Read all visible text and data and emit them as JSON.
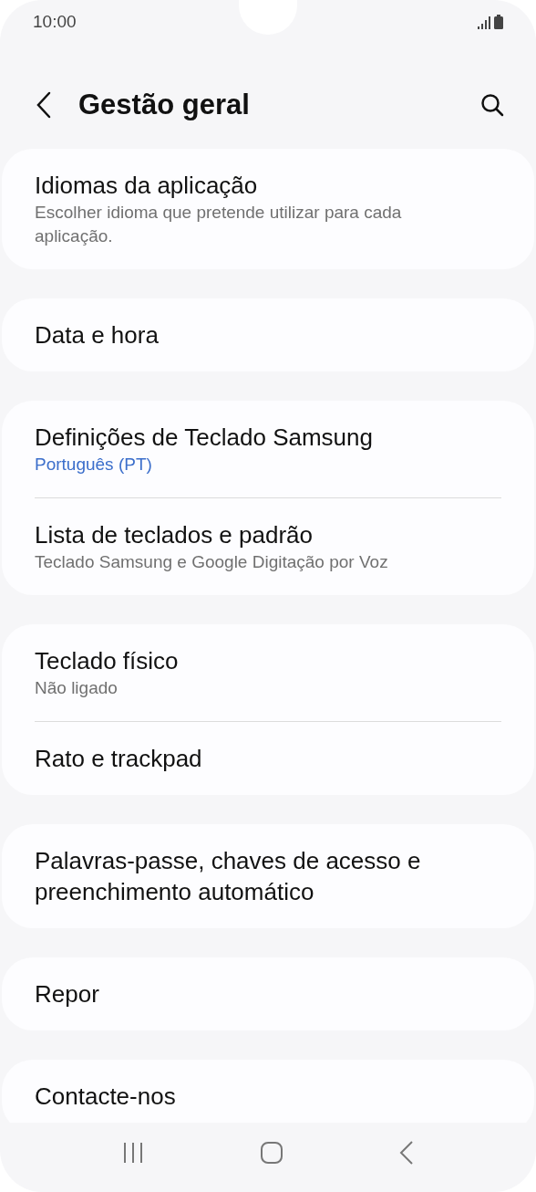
{
  "status_bar": {
    "time": "10:00"
  },
  "header": {
    "title": "Gestão geral"
  },
  "cards": [
    {
      "items": [
        {
          "title": "Idiomas da aplicação",
          "subtitle": {
            "text": "Escolher idioma que pretende utilizar para cada aplicação.",
            "color": "#707070"
          }
        }
      ]
    },
    {
      "items": [
        {
          "title": "Data e hora"
        }
      ]
    },
    {
      "items": [
        {
          "title": "Definições de Teclado Samsung",
          "subtitle": {
            "text": "Português (PT)",
            "color": "#3b6ecb"
          }
        },
        {
          "title": "Lista de teclados e padrão",
          "subtitle": {
            "text": "Teclado Samsung e Google Digitação por Voz",
            "color": "#707070"
          }
        }
      ]
    },
    {
      "items": [
        {
          "title": "Teclado físico",
          "subtitle": {
            "text": "Não ligado",
            "color": "#707070"
          }
        },
        {
          "title": "Rato e trackpad"
        }
      ]
    },
    {
      "items": [
        {
          "title": "Palavras-passe, chaves de acesso e preenchimento automático"
        }
      ]
    },
    {
      "items": [
        {
          "title": "Repor"
        }
      ]
    },
    {
      "items": [
        {
          "title": "Contacte-nos"
        }
      ]
    }
  ]
}
